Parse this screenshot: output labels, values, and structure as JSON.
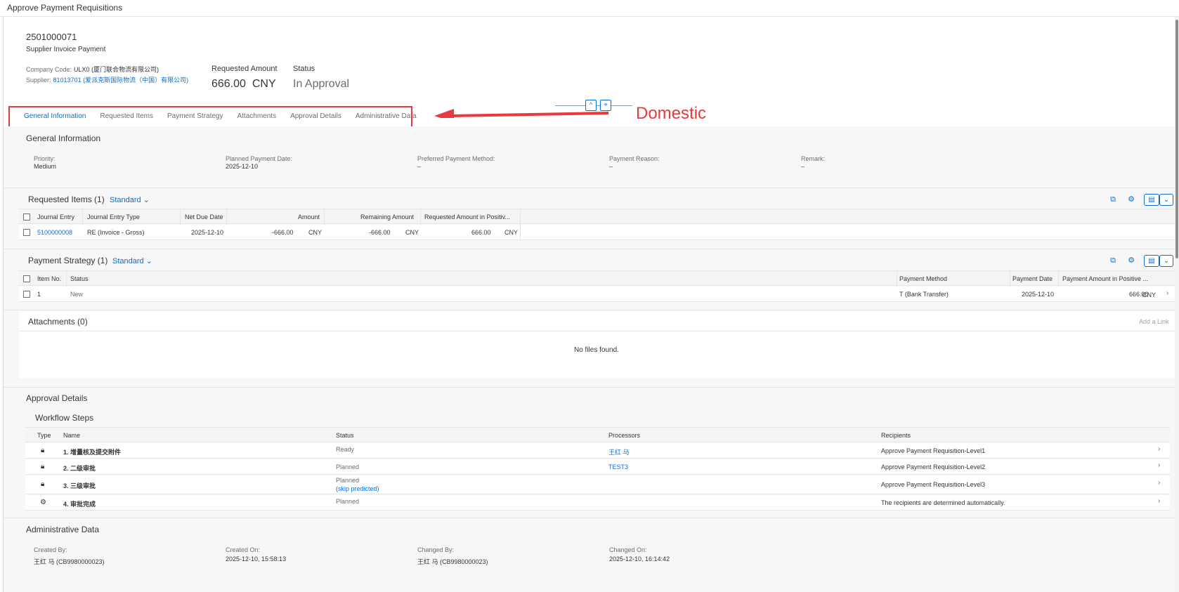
{
  "window": {
    "title": "Approve Payment Requisitions"
  },
  "header": {
    "id": "2501000071",
    "subtitle": "Supplier Invoice Payment",
    "company_code_label": "Company Code:",
    "company_code_value": "ULX0 (厦门联合物流有限公司)",
    "supplier_label": "Supplier:",
    "supplier_value": "81013701 (爱派克斯国际物流（中国）有限公司)",
    "requested_amount_label": "Requested Amount",
    "requested_amount_value": "666.00",
    "requested_amount_currency": "CNY",
    "status_label": "Status",
    "status_value": "In Approval"
  },
  "tabs": [
    {
      "label": "General Information",
      "active": true
    },
    {
      "label": "Requested Items"
    },
    {
      "label": "Payment Strategy"
    },
    {
      "label": "Attachments"
    },
    {
      "label": "Approval Details"
    },
    {
      "label": "Administrative Data"
    }
  ],
  "annotation": {
    "text": "Domestic",
    "color": "#e9393c"
  },
  "general_info": {
    "title": "General Information",
    "priority_label": "Priority:",
    "priority_value": "Medium",
    "planned_date_label": "Planned Payment Date:",
    "planned_date_value": "2025-12-10",
    "pref_method_label": "Preferred Payment Method:",
    "pref_method_value": "–",
    "reason_label": "Payment Reason:",
    "reason_value": "–",
    "remark_label": "Remark:",
    "remark_value": "–"
  },
  "requested_items": {
    "title": "Requested Items (1)",
    "variant": "Standard",
    "columns": [
      "Journal Entry",
      "Journal Entry Type",
      "Net Due Date",
      "Amount",
      "Remaining Amount",
      "Requested Amount in Positiv..."
    ],
    "rows": [
      {
        "journal_entry": "5100000008",
        "type": "RE (Invoice - Gross)",
        "net_due_date": "2025-12-10",
        "amount": "-666.00",
        "amount_cur": "CNY",
        "remaining": "-666.00",
        "remaining_cur": "CNY",
        "requested": "666.00",
        "requested_cur": "CNY"
      }
    ]
  },
  "payment_strategy": {
    "title": "Payment Strategy (1)",
    "variant": "Standard",
    "columns": [
      "Item No.",
      "Status",
      "Payment Method",
      "Payment Date",
      "Payment Amount in Positive ..."
    ],
    "rows": [
      {
        "item_no": "1",
        "status": "New",
        "method": "T (Bank Transfer)",
        "date": "2025-12-10",
        "amount": "666.00",
        "cur": "CNY"
      }
    ]
  },
  "attachments": {
    "title": "Attachments (0)",
    "add_link": "Add a Link",
    "empty": "No files found."
  },
  "approval": {
    "title": "Approval Details",
    "subtitle": "Workflow Steps",
    "columns": [
      "Type",
      "Name",
      "Status",
      "Processors",
      "Recipients"
    ],
    "rows": [
      {
        "icon": "lock-icon",
        "name": "1. 增量核及提交附件",
        "status": "Ready",
        "status2": "",
        "processor": "王红 马",
        "recipients": "Approve Payment Requisition-Level1"
      },
      {
        "icon": "lock-icon",
        "name": "2. 二级审批",
        "status": "Planned",
        "status2": "",
        "processor": "TEST3",
        "recipients": "Approve Payment Requisition-Level2"
      },
      {
        "icon": "lock-icon",
        "name": "3. 三级审批",
        "status": "Planned",
        "status2": "(skip predicted)",
        "processor": "",
        "recipients": "Approve Payment Requisition-Level3"
      },
      {
        "icon": "automation-icon",
        "name": "4. 审批完成",
        "status": "Planned",
        "status2": "",
        "processor": "",
        "recipients": "The recipients are determined automatically."
      }
    ]
  },
  "admin": {
    "title": "Administrative Data",
    "created_by_label": "Created By:",
    "created_by_value": "王红 马 (CB9980000023)",
    "created_on_label": "Created On:",
    "created_on_value": "2025-12-10, 15:58:13",
    "changed_by_label": "Changed By:",
    "changed_by_value": "王红 马 (CB9980000023)",
    "changed_on_label": "Changed On:",
    "changed_on_value": "2025-12-10, 16:14:42"
  }
}
